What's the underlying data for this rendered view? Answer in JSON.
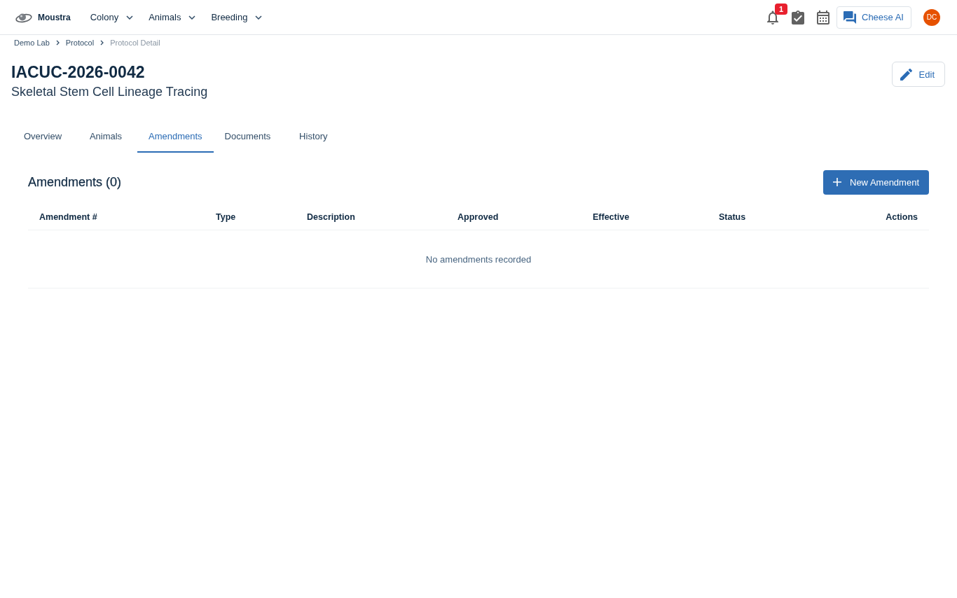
{
  "header": {
    "brand": "Moustra",
    "nav": [
      {
        "label": "Colony"
      },
      {
        "label": "Animals"
      },
      {
        "label": "Breeding"
      }
    ],
    "notification_badge": "1",
    "assistant_button": "Cheese AI",
    "avatar_initials": "DC"
  },
  "breadcrumb": [
    {
      "label": "Demo Lab",
      "current": false
    },
    {
      "label": "Protocol",
      "current": false
    },
    {
      "label": "Protocol Detail",
      "current": true
    }
  ],
  "page": {
    "title": "IACUC-2026-0042",
    "subtitle": "Skeletal Stem Cell Lineage Tracing",
    "edit_button": "Edit"
  },
  "tabs": [
    {
      "label": "Overview",
      "selected": false
    },
    {
      "label": "Animals",
      "selected": false
    },
    {
      "label": "Amendments",
      "selected": true
    },
    {
      "label": "Documents",
      "selected": false
    },
    {
      "label": "History",
      "selected": false
    }
  ],
  "amendments": {
    "title": "Amendments (0)",
    "new_button": "New Amendment",
    "table": {
      "columns": [
        "Amendment #",
        "Type",
        "Description",
        "Approved",
        "Effective",
        "Status",
        "Actions"
      ],
      "empty_message": "No amendments recorded"
    }
  }
}
